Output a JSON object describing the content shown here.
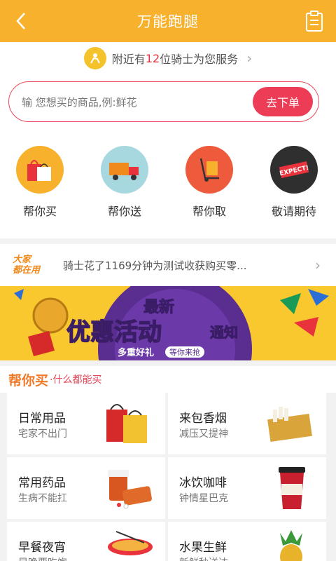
{
  "header": {
    "title": "万能跑腿"
  },
  "riders": {
    "prefix": "附近有",
    "count": "12",
    "suffix": "位骑士为您服务"
  },
  "search": {
    "placeholder": "输 您想买的商品,例:鲜花",
    "button": "去下单"
  },
  "services": [
    {
      "label": "帮你买"
    },
    {
      "label": "帮你送"
    },
    {
      "label": "帮你取"
    },
    {
      "label": "敬请期待"
    }
  ],
  "notice": {
    "tag_line1": "大家",
    "tag_line2": "都在用",
    "text": "骑士花了1169分钟为测试收获购买零..."
  },
  "banner": {
    "line1": "最新",
    "line2": "优惠活动",
    "line3": "通知",
    "pill1": "多重好礼",
    "pill2": "等你来抢"
  },
  "section": {
    "title": "帮你买",
    "subtitle": "·什么都能买"
  },
  "categories": [
    {
      "name": "日常用品",
      "desc": "宅家不出门"
    },
    {
      "name": "来包香烟",
      "desc": "减压又提神"
    },
    {
      "name": "常用药品",
      "desc": "生病不能扛"
    },
    {
      "name": "冰饮咖啡",
      "desc": "钟情星巴克"
    },
    {
      "name": "早餐夜宵",
      "desc": "早晚要吃饱"
    },
    {
      "name": "水果生鲜",
      "desc": "新鲜秒送达"
    }
  ],
  "colors": {
    "header": "#f7b12d",
    "accent": "#ed3d56",
    "orange_text": "#f07a2a"
  }
}
